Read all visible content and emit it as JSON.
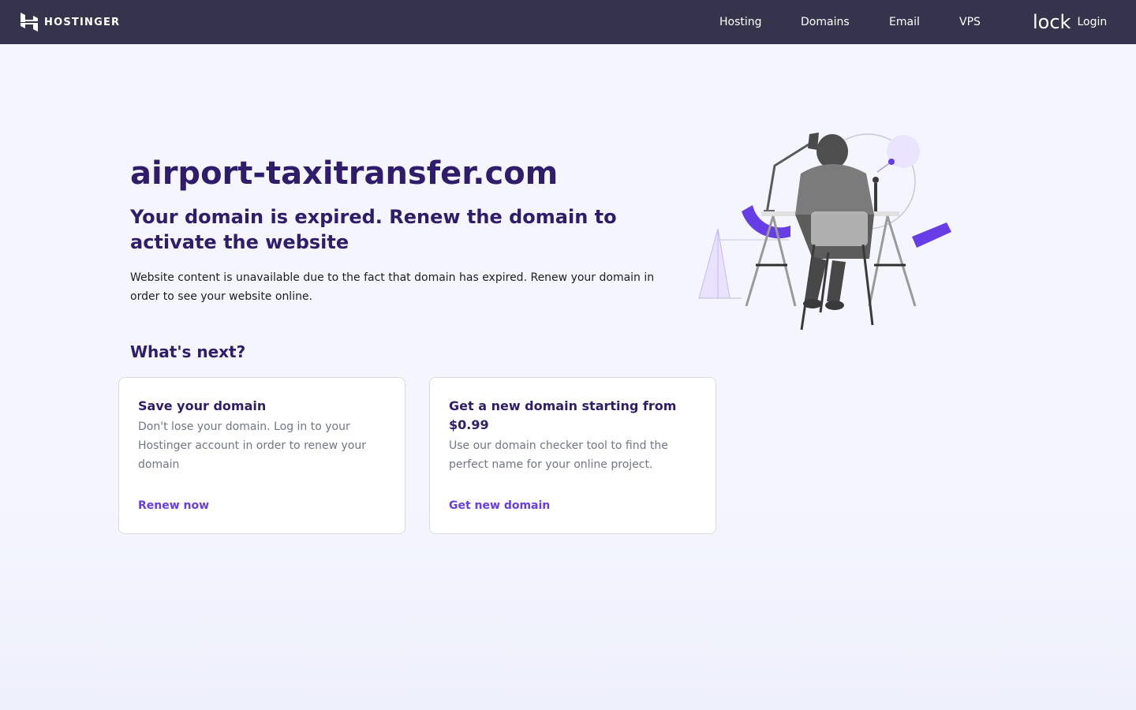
{
  "header": {
    "brand": "HOSTINGER",
    "nav": [
      "Hosting",
      "Domains",
      "Email",
      "VPS"
    ],
    "login_icon_text": "lock",
    "login_label": "Login"
  },
  "main": {
    "domain": "airport-taxitransfer.com",
    "status_heading": "Your domain is expired. Renew the domain to activate the website",
    "description": "Website content is unavailable due to the fact that domain has expired. Renew your domain in order to see your website online.",
    "next_heading": "What's next?",
    "cards": [
      {
        "title": "Save your domain",
        "text": "Don't lose your domain. Log in to your Hostinger account in order to renew your domain",
        "link": "Renew now"
      },
      {
        "title": "Get a new domain starting from $0.99",
        "text": "Use our domain checker tool to find the perfect name for your online project.",
        "link": "Get new domain"
      }
    ]
  },
  "colors": {
    "header_bg": "#36344d",
    "heading": "#2f1c6a",
    "accent": "#673de6",
    "page_bg": "#f4f5ff"
  },
  "icons": {
    "logo": "hostinger-logo-icon",
    "illustration": "person-at-desk-illustration"
  }
}
